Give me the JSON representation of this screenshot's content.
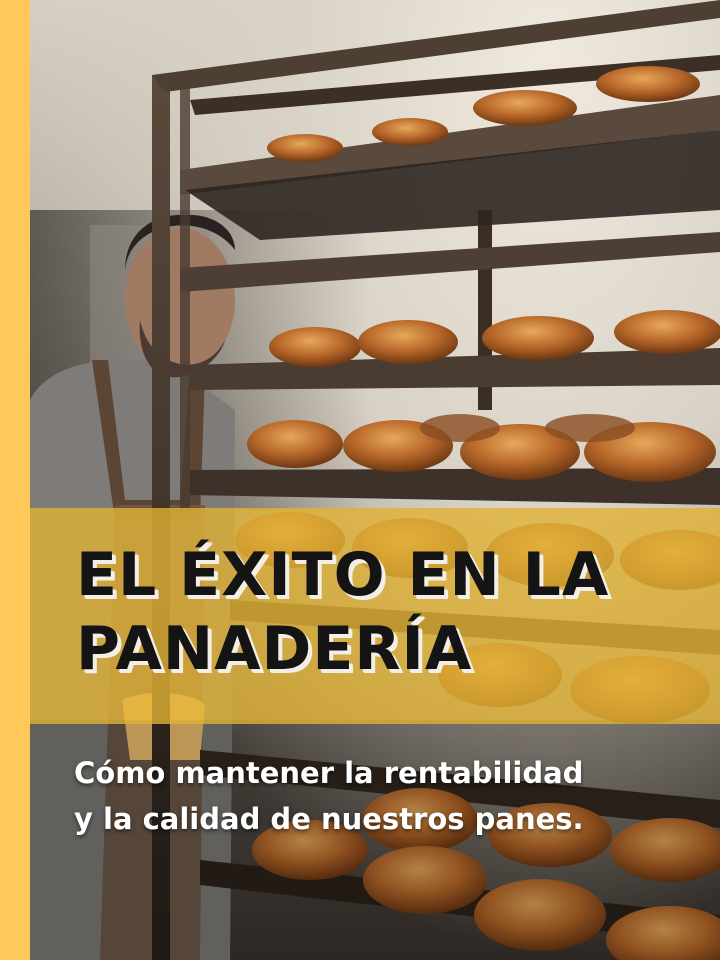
{
  "cover": {
    "title_line1": "EL ÉXITO EN LA",
    "title_line2": "PANADERÍA",
    "subtitle_line1": "Cómo mantener la rentabilidad",
    "subtitle_line2": "y la calidad de nuestros panes."
  },
  "colors": {
    "accent": "#ffc95a",
    "banner": "#e0b234",
    "title_text": "#141414",
    "subtitle_text": "#ffffff"
  },
  "photo": {
    "subject": "baker-with-bread-rack",
    "icons": [
      "bread-rack-icon",
      "baker-icon",
      "bun-icon"
    ]
  }
}
